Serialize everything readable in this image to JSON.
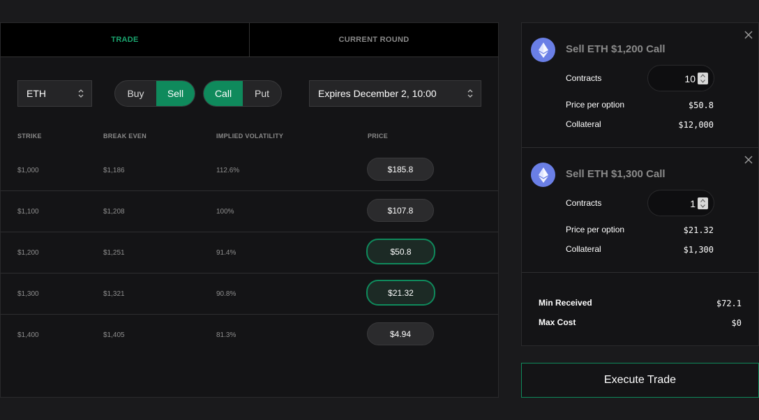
{
  "tabs": [
    {
      "label": "TRADE",
      "active": true
    },
    {
      "label": "CURRENT ROUND",
      "active": false
    }
  ],
  "controls": {
    "asset": "ETH",
    "buy_label": "Buy",
    "sell_label": "Sell",
    "call_label": "Call",
    "put_label": "Put",
    "expiry": "Expires December 2, 10:00",
    "side_selected": "Sell",
    "type_selected": "Call"
  },
  "table": {
    "headers": [
      "STRIKE",
      "BREAK EVEN",
      "IMPLIED VOLATILITY",
      "PRICE"
    ],
    "rows": [
      {
        "strike": "$1,000",
        "break_even": "$1,186",
        "iv": "112.6%",
        "price": "$185.8",
        "selected": false
      },
      {
        "strike": "$1,100",
        "break_even": "$1,208",
        "iv": "100%",
        "price": "$107.8",
        "selected": false
      },
      {
        "strike": "$1,200",
        "break_even": "$1,251",
        "iv": "91.4%",
        "price": "$50.8",
        "selected": true
      },
      {
        "strike": "$1,300",
        "break_even": "$1,321",
        "iv": "90.8%",
        "price": "$21.32",
        "selected": true
      },
      {
        "strike": "$1,400",
        "break_even": "$1,405",
        "iv": "81.3%",
        "price": "$4.94",
        "selected": false
      }
    ]
  },
  "orders": [
    {
      "title": "Sell ETH $1,200 Call",
      "contracts_label": "Contracts",
      "contracts": "10",
      "price_label": "Price per option",
      "price": "$50.8",
      "collateral_label": "Collateral",
      "collateral": "$12,000",
      "icon": "ethereum-icon"
    },
    {
      "title": "Sell ETH $1,300 Call",
      "contracts_label": "Contracts",
      "contracts": "1",
      "price_label": "Price per option",
      "price": "$21.32",
      "collateral_label": "Collateral",
      "collateral": "$1,300",
      "icon": "ethereum-icon"
    }
  ],
  "totals": {
    "min_received_label": "Min Received",
    "min_received": "$72.1",
    "max_cost_label": "Max Cost",
    "max_cost": "$0"
  },
  "execute_label": "Execute Trade",
  "colors": {
    "accent": "#0f8a5c",
    "accent_text": "#1aa56f",
    "eth": "#6a7fe6"
  }
}
